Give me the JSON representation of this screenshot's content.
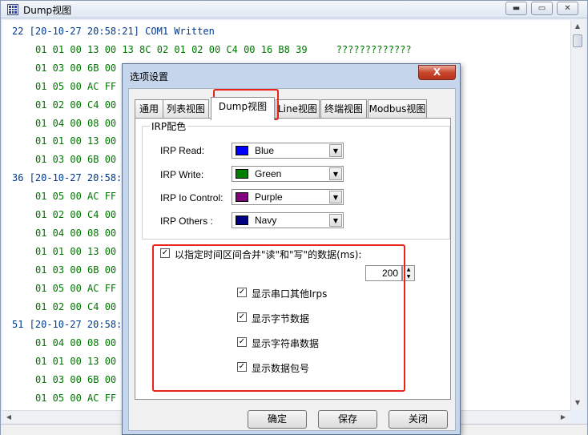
{
  "window": {
    "title": "Dump视图"
  },
  "log": {
    "lines": [
      {
        "text": "22 [20-10-27 20:58:21] COM1 Written",
        "kind": "head",
        "indent": false
      },
      {
        "text": "01 01 00 13 00 13 8C 02 01 02 00 C4 00 16 B8 39     ?????????????",
        "kind": "data",
        "indent": true
      },
      {
        "text": "01 03 00 6B 00 0",
        "kind": "data",
        "indent": true
      },
      {
        "text": "01 05 00 AC FF 0",
        "kind": "data",
        "indent": true
      },
      {
        "text": "01 02 00 C4 00 1",
        "kind": "data",
        "indent": true
      },
      {
        "text": "01 04 00 08 00 0",
        "kind": "data",
        "indent": true
      },
      {
        "text": "01 01 00 13 00 1",
        "kind": "data",
        "indent": true
      },
      {
        "text": "01 03 00 6B 00 0",
        "kind": "data",
        "indent": true
      },
      {
        "text": "36 [20-10-27 20:58:2",
        "kind": "head",
        "indent": false
      },
      {
        "text": "01 05 00 AC FF 0",
        "kind": "data",
        "indent": true
      },
      {
        "text": "01 02 00 C4 00 1",
        "kind": "data",
        "indent": true
      },
      {
        "text": "01 04 00 08 00 0",
        "kind": "data",
        "indent": true
      },
      {
        "text": "01 01 00 13 00 1",
        "kind": "data",
        "indent": true
      },
      {
        "text": "01 03 00 6B 00 0",
        "kind": "data",
        "indent": true
      },
      {
        "text": "01 05 00 AC FF 0",
        "kind": "data",
        "indent": true
      },
      {
        "text": "01 02 00 C4 00 1",
        "kind": "data",
        "indent": true
      },
      {
        "text": "51 [20-10-27 20:58:2",
        "kind": "head",
        "indent": false
      },
      {
        "text": "01 04 00 08 00 0",
        "kind": "data",
        "indent": true
      },
      {
        "text": "01 01 00 13 00 1",
        "kind": "data",
        "indent": true
      },
      {
        "text": "01 03 00 6B 00 0",
        "kind": "data",
        "indent": true
      },
      {
        "text": "01 05 00 AC FF 0",
        "kind": "data",
        "indent": true
      }
    ]
  },
  "dialog": {
    "title": "选项设置",
    "close_label": "X",
    "tabs": [
      "通用",
      "列表视图",
      "Dump视图",
      "Line视图",
      "终端视图",
      "Modbus视图"
    ],
    "active_tab": "Dump视图",
    "group": {
      "label": "IRP配色",
      "rows": [
        {
          "label": "IRP Read:",
          "color_name": "Blue",
          "color": "#0000ff"
        },
        {
          "label": "IRP Write:",
          "color_name": "Green",
          "color": "#008000"
        },
        {
          "label": "IRP Io Control:",
          "color_name": "Purple",
          "color": "#800080"
        },
        {
          "label": "IRP Others :",
          "color_name": "Navy",
          "color": "#000080"
        }
      ]
    },
    "merge": {
      "label": "以指定时间区间合并\"读\"和\"写\"的数据(ms):",
      "checked": true,
      "value": "200"
    },
    "options": [
      {
        "label": "显示串口其他Irps",
        "checked": true
      },
      {
        "label": "显示字节数据",
        "checked": true
      },
      {
        "label": "显示字符串数据",
        "checked": true
      },
      {
        "label": "显示数据包号",
        "checked": true
      }
    ],
    "buttons": {
      "ok": "确定",
      "save": "保存",
      "close": "关闭"
    }
  },
  "colors": {
    "highlight": "#e8231b",
    "log_head": "#003a8c",
    "log_data": "#007700"
  }
}
